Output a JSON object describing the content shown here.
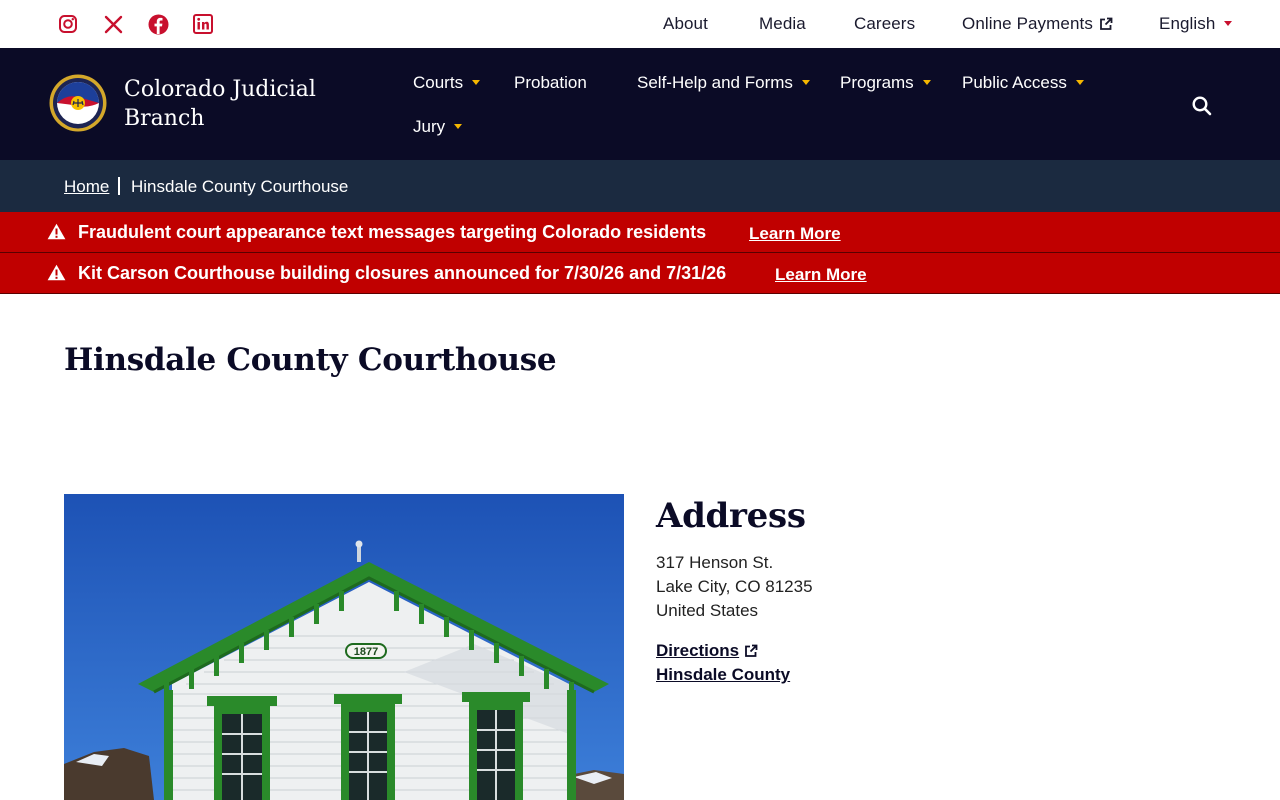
{
  "colors": {
    "brand_red": "#c8102e",
    "navy": "#0b0b26",
    "breadcrumb_bg": "#1b2a40",
    "alert_red": "#c00000",
    "accent_gold": "#f5b700"
  },
  "social": [
    {
      "name": "instagram-icon"
    },
    {
      "name": "x-twitter-icon"
    },
    {
      "name": "facebook-icon"
    },
    {
      "name": "linkedin-icon"
    }
  ],
  "utility_nav": {
    "about": "About",
    "media": "Media",
    "careers": "Careers",
    "online_payments": "Online Payments",
    "language": "English"
  },
  "brand": {
    "line1": "Colorado Judicial",
    "line2": "Branch"
  },
  "main_nav": {
    "courts": "Courts",
    "probation": "Probation",
    "self_help": "Self-Help and Forms",
    "programs": "Programs",
    "public_access": "Public Access",
    "jury": "Jury"
  },
  "breadcrumb": {
    "home": "Home",
    "current": "Hinsdale County Courthouse"
  },
  "alerts": [
    {
      "text": "Fraudulent court appearance text messages targeting Colorado residents",
      "link": "Learn More"
    },
    {
      "text": "Kit Carson Courthouse building closures announced for 7/30/26 and 7/31/26",
      "link": "Learn More"
    }
  ],
  "page": {
    "title": "Hinsdale County Courthouse"
  },
  "photo": {
    "year_sign": "1877"
  },
  "address": {
    "heading": "Address",
    "street": "317 Henson St.",
    "city_line": "Lake City, CO 81235",
    "country": "United States",
    "directions": "Directions",
    "county": "Hinsdale County"
  }
}
